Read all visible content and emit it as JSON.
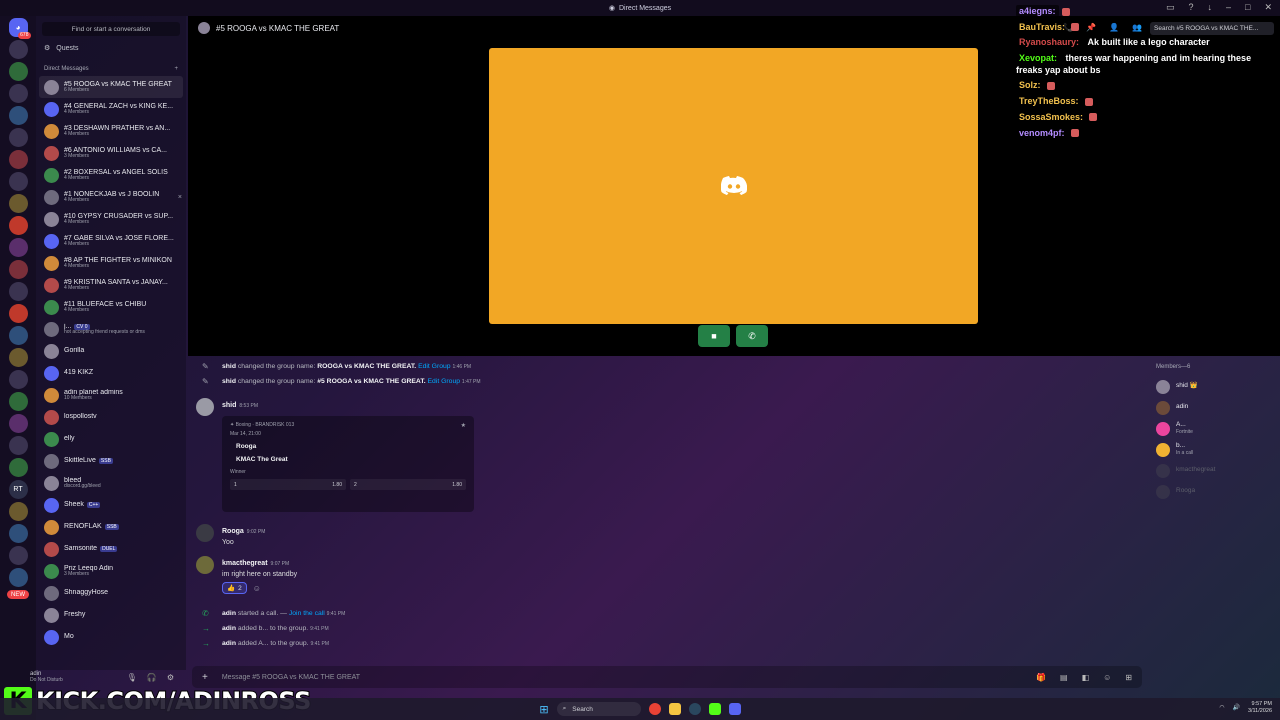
{
  "window": {
    "title": "Direct Messages"
  },
  "sidebar": {
    "find_placeholder": "Find or start a conversation",
    "quests_label": "Quests",
    "dm_header": "Direct Messages",
    "home_badge": "678",
    "dms": [
      {
        "name": "#5 ROOGA vs KMAC THE GREAT",
        "sub": "6 Members",
        "active": true
      },
      {
        "name": "#4 GENERAL ZACH vs KING KE...",
        "sub": "4 Members"
      },
      {
        "name": "#3 DESHAWN PRATHER vs AN...",
        "sub": "4 Members"
      },
      {
        "name": "#6 ANTONIO WILLIAMS vs CA...",
        "sub": "3 Members"
      },
      {
        "name": "#2 BOXERSAL vs ANGEL SOLIS",
        "sub": "4 Members"
      },
      {
        "name": "#1 NONECKJAB vs J BOOLIN",
        "sub": "4 Members",
        "close": "×"
      },
      {
        "name": "#10 GYPSY CRUSADER vs SUP...",
        "sub": "4 Members"
      },
      {
        "name": "#7 GABE SILVA vs JOSE FLORE...",
        "sub": "4 Members"
      },
      {
        "name": "#8 AP THE FIGHTER vs MINIKON",
        "sub": "4 Members"
      },
      {
        "name": "#9 KRISTINA SANTA vs JANAY...",
        "sub": "4 Members"
      },
      {
        "name": "#11 BLUEFACE vs CHIBU",
        "sub": "4 Members"
      },
      {
        "name": "j...",
        "sub": "not accepting friend requests or dms",
        "tag": "CV 0"
      },
      {
        "name": "Gorilla",
        "sub": ""
      },
      {
        "name": "419 KIKZ",
        "sub": ""
      },
      {
        "name": "adin planet admins",
        "sub": "10 Members"
      },
      {
        "name": "lospollostv",
        "sub": ""
      },
      {
        "name": "elly",
        "sub": ""
      },
      {
        "name": "SkittleLive",
        "sub": "",
        "tag": "SSB"
      },
      {
        "name": "bleed",
        "sub": "discord.gg/bleed"
      },
      {
        "name": "Sheek",
        "sub": "",
        "tag": "C++"
      },
      {
        "name": "RENOFLAK",
        "sub": "",
        "tag": "SSB"
      },
      {
        "name": "Samsonite",
        "sub": "",
        "tag": "DUEL"
      },
      {
        "name": "Priz Leeqo Adin",
        "sub": "3 Members"
      },
      {
        "name": "ShnaggyHose",
        "sub": ""
      },
      {
        "name": "Freshy",
        "sub": ""
      },
      {
        "name": "Mo",
        "sub": ""
      }
    ]
  },
  "user_panel": {
    "name": "adin",
    "status": "Do Not Disturb"
  },
  "kick_overlay": {
    "letter": "K",
    "text": "KICK.COM/ADINROSS"
  },
  "call": {
    "title": "#5 ROOGA vs KMAC THE GREAT",
    "search_placeholder": "Search #5 ROOGA vs KMAC THE...",
    "tile_color": "#f2a725"
  },
  "kick_chat": [
    {
      "user": "a4iegns:",
      "color": "#b38cff",
      "msg": ""
    },
    {
      "user": "BauTravis:",
      "color": "#f2c14e",
      "msg": ""
    },
    {
      "user": "Ryanoshaury:",
      "color": "#d34a4a",
      "msg": "Ak built like a lego character"
    },
    {
      "user": "Xevopat:",
      "color": "#53fc18",
      "msg": "theres war happening and im hearing these freaks yap about bs"
    },
    {
      "user": "Solz:",
      "color": "#f2c14e",
      "msg": ""
    },
    {
      "user": "TreyTheBoss:",
      "color": "#f2c14e",
      "msg": ""
    },
    {
      "user": "SossaSmokes:",
      "color": "#f2c14e",
      "msg": ""
    },
    {
      "user": "venom4pf:",
      "color": "#b38cff",
      "msg": ""
    }
  ],
  "chat": {
    "sys1": {
      "user": "shid",
      "text": "changed the group name:",
      "value": "ROOGA vs KMAC THE GREAT.",
      "link": "Edit Group",
      "ts": "1:46 PM"
    },
    "sys2": {
      "user": "shid",
      "text": "changed the group name:",
      "value": "#5 ROOGA vs KMAC THE GREAT.",
      "link": "Edit Group",
      "ts": "1:47 PM"
    },
    "msg1": {
      "author": "shid",
      "ts": "8:53 PM",
      "embed": {
        "league": "Boxing · BRANDRISK 013",
        "date": "Mar 14, 21:00",
        "f1": "Rooga",
        "f2": "KMAC The Great",
        "market": "Winner",
        "o1_label": "1",
        "o1": "1.80",
        "o2_label": "2",
        "o2": "1.80"
      }
    },
    "msg2": {
      "author": "Rooga",
      "ts": "9:02 PM",
      "text": "Yoo"
    },
    "msg3": {
      "author": "kmacthegreat",
      "ts": "9:07 PM",
      "text": "im right here on standby",
      "reaction_emoji": "👍",
      "reaction_count": "2"
    },
    "sys3": {
      "user": "adin",
      "text": "started a call. —",
      "link": "Join the call",
      "ts": "9:41 PM"
    },
    "sys4": {
      "user": "adin",
      "text": "added b... to the group.",
      "ts": "9:41 PM"
    },
    "sys5": {
      "user": "adin",
      "text": "added A... to the group.",
      "ts": "9:41 PM"
    }
  },
  "composer": {
    "placeholder": "Message #5 ROOGA vs KMAC THE GREAT"
  },
  "members": {
    "header": "Members—6",
    "list": [
      {
        "name": "shid 👑",
        "sub": ""
      },
      {
        "name": "adin",
        "sub": ""
      },
      {
        "name": "A...",
        "sub": "Fortnite"
      },
      {
        "name": "b...",
        "sub": "In a call"
      },
      {
        "name": "kmacthegreat",
        "sub": "",
        "dim": true
      },
      {
        "name": "Rooga",
        "sub": "",
        "dim": true
      }
    ]
  },
  "taskbar": {
    "search": "Search",
    "time": "9:57 PM",
    "date": "3/11/2026"
  }
}
